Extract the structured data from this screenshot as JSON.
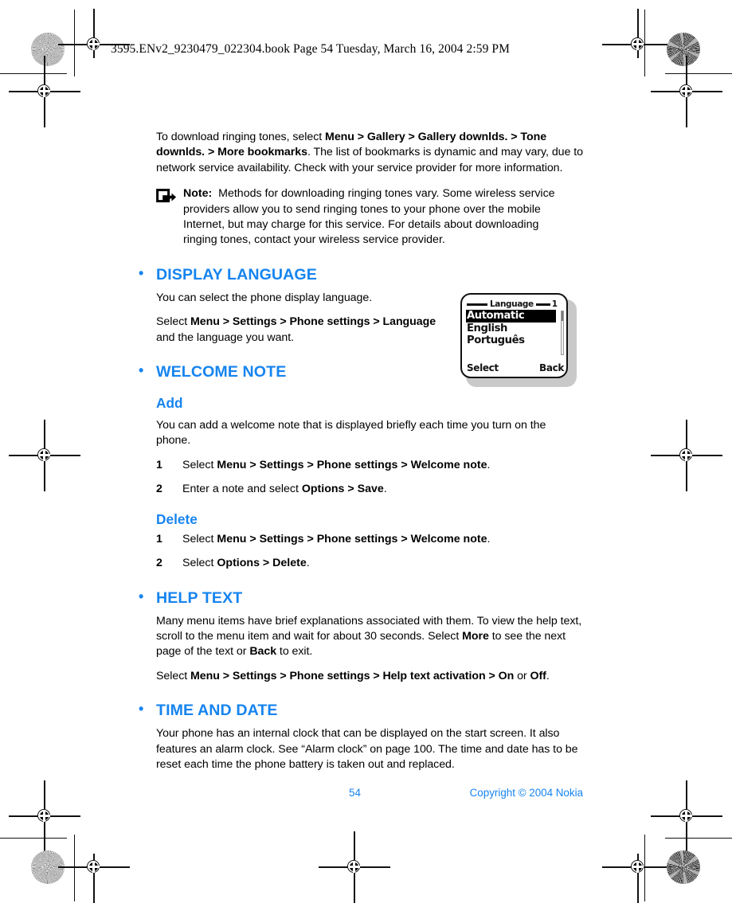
{
  "header": {
    "text": "3595.ENv2_9230479_022304.book  Page 54  Tuesday, March 16, 2004  2:59 PM"
  },
  "intro": {
    "p1_a": "To download ringing tones, select ",
    "p1_b1": "Menu > Gallery > Gallery downlds. > Tone downlds. > More bookmarks",
    "p1_c": ". The list of bookmarks is dynamic and may vary, due to network service availability. Check with your service provider for more information."
  },
  "note": {
    "icon": "note-arrow-icon",
    "label": "Note:",
    "body": "Methods for downloading ringing tones vary. Some wireless service providers allow you to send ringing tones to your phone over the mobile Internet, but may charge for this service. For details about downloading ringing tones, contact your wireless service provider."
  },
  "sections": {
    "display_language": {
      "heading": "DISPLAY LANGUAGE",
      "p1": "You can select the phone display language.",
      "p2_a": "Select ",
      "p2_b": "Menu > Settings > Phone settings > Language",
      "p2_c": " and the language you want."
    },
    "welcome_note": {
      "heading": "WELCOME NOTE",
      "add": {
        "subheading": "Add",
        "p1": "You can add a welcome note that is displayed briefly each time you turn on the phone.",
        "steps": [
          {
            "num": "1",
            "a": "Select ",
            "b": "Menu > Settings > Phone settings > Welcome note",
            "c": "."
          },
          {
            "num": "2",
            "a": "Enter a note and select ",
            "b": "Options > Save",
            "c": "."
          }
        ]
      },
      "delete": {
        "subheading": "Delete",
        "steps": [
          {
            "num": "1",
            "a": "Select ",
            "b": "Menu > Settings > Phone settings > Welcome note",
            "c": "."
          },
          {
            "num": "2",
            "a": "Select ",
            "b": "Options > Delete",
            "c": "."
          }
        ]
      }
    },
    "help_text": {
      "heading": "HELP TEXT",
      "p1_a": "Many menu items have brief explanations associated with them. To view the help text, scroll to the menu item and wait for about 30 seconds. Select ",
      "p1_b": "More",
      "p1_c": " to see the next page of the text or ",
      "p1_d": "Back",
      "p1_e": " to exit.",
      "p2_a": "Select ",
      "p2_b": "Menu > Settings > Phone settings > Help text activation > On",
      "p2_c": " or ",
      "p2_d": "Off",
      "p2_e": "."
    },
    "time_and_date": {
      "heading": "TIME AND DATE",
      "p1": "Your phone has an internal clock that can be displayed on the start screen. It also features an alarm clock. See “Alarm clock” on page 100. The time and date has to be reset each time the phone battery is taken out and replaced."
    }
  },
  "phone_screenshot": {
    "title": "Language",
    "index": "1",
    "items": [
      {
        "label": "Automatic",
        "selected": true
      },
      {
        "label": "English",
        "selected": false
      },
      {
        "label": "Português",
        "selected": false
      }
    ],
    "softkey_left": "Select",
    "softkey_right": "Back"
  },
  "footer": {
    "page_number": "54",
    "copyright": "Copyright © 2004 Nokia"
  },
  "colors": {
    "heading_blue": "#1684ef",
    "footer_blue": "#1684ef",
    "text_black": "#000000"
  }
}
